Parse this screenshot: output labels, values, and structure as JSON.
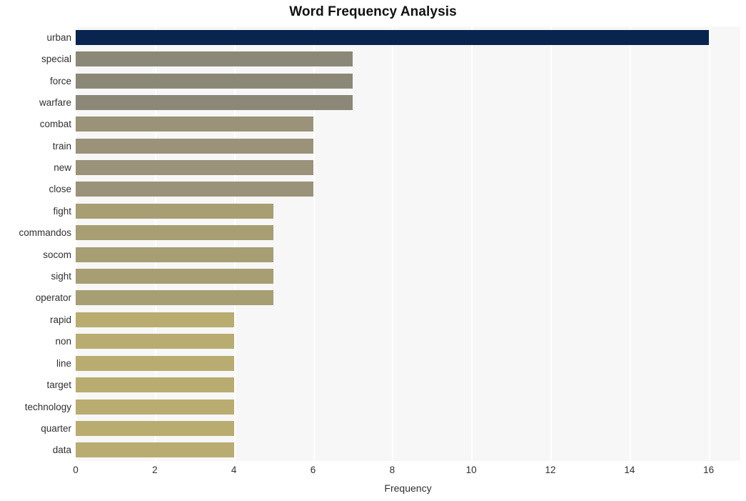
{
  "chart_data": {
    "type": "bar",
    "orientation": "horizontal",
    "title": "Word Frequency Analysis",
    "xlabel": "Frequency",
    "ylabel": "",
    "xlim": [
      0,
      16.8
    ],
    "xticks": [
      0,
      2,
      4,
      6,
      8,
      10,
      12,
      14,
      16
    ],
    "grid": true,
    "legend": "none",
    "categories": [
      "urban",
      "special",
      "force",
      "warfare",
      "combat",
      "train",
      "new",
      "close",
      "fight",
      "commandos",
      "socom",
      "sight",
      "operator",
      "rapid",
      "non",
      "line",
      "target",
      "technology",
      "quarter",
      "data"
    ],
    "values": [
      16,
      7,
      7,
      7,
      6,
      6,
      6,
      6,
      5,
      5,
      5,
      5,
      5,
      4,
      4,
      4,
      4,
      4,
      4,
      4
    ],
    "bar_colors": [
      "#0a2450",
      "#8b8878",
      "#8b8878",
      "#8b8878",
      "#9a9279",
      "#9a9279",
      "#9a9279",
      "#9a9279",
      "#a79e73",
      "#a79e73",
      "#a79e73",
      "#a79e73",
      "#a79e73",
      "#b8ac70",
      "#b8ac70",
      "#b8ac70",
      "#b8ac70",
      "#b8ac70",
      "#b8ac70",
      "#b8ac70"
    ],
    "plot_bgcolor": "#f7f7f7",
    "gridline_color": "#ffffff",
    "text_color": "#303030",
    "title_color": "#111111"
  }
}
